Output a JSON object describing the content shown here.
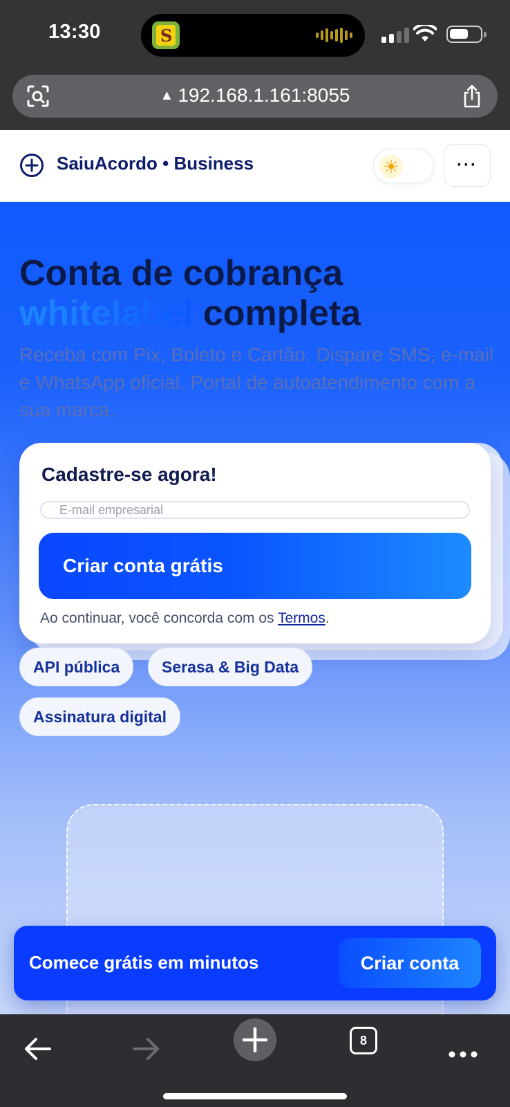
{
  "status_bar": {
    "time": "13:30"
  },
  "browser": {
    "url": "192.168.1.161:8055",
    "open_tabs_count": "8"
  },
  "header": {
    "brand": "SaiuAcordo • Business",
    "menu_label": "···"
  },
  "hero": {
    "title_line1": "Conta de cobrança",
    "title_highlight": "whitelabel",
    "title_line2_rest": "completa",
    "subtitle": "Receba com Pix, Boleto e Cartão. Dispare SMS, e-mail e WhatsApp oficial. Portal de autoatendimento com a sua marca."
  },
  "signup_card": {
    "title": "Cadastre-se agora!",
    "email_placeholder": "E-mail empresarial",
    "email_value": "",
    "cta_label": "Criar conta grátis",
    "terms_prefix": "Ao continuar, você concorda com os ",
    "terms_link": "Termos",
    "terms_suffix": "."
  },
  "features": [
    "API pública",
    "Serasa & Big Data",
    "Assinatura digital"
  ],
  "sticky_cta": {
    "text": "Comece grátis em minutos",
    "button_label": "Criar conta"
  },
  "colors": {
    "brand_blue": "#0a3cff",
    "brand_navy": "#0d1d6b",
    "accent_light_blue": "#1d8bff"
  },
  "icons": {
    "logo": "plus-circle-icon",
    "theme": "sun-icon",
    "back": "arrow-left-icon",
    "forward": "arrow-right-icon",
    "new_tab": "plus-icon",
    "more": "ellipsis-icon"
  }
}
